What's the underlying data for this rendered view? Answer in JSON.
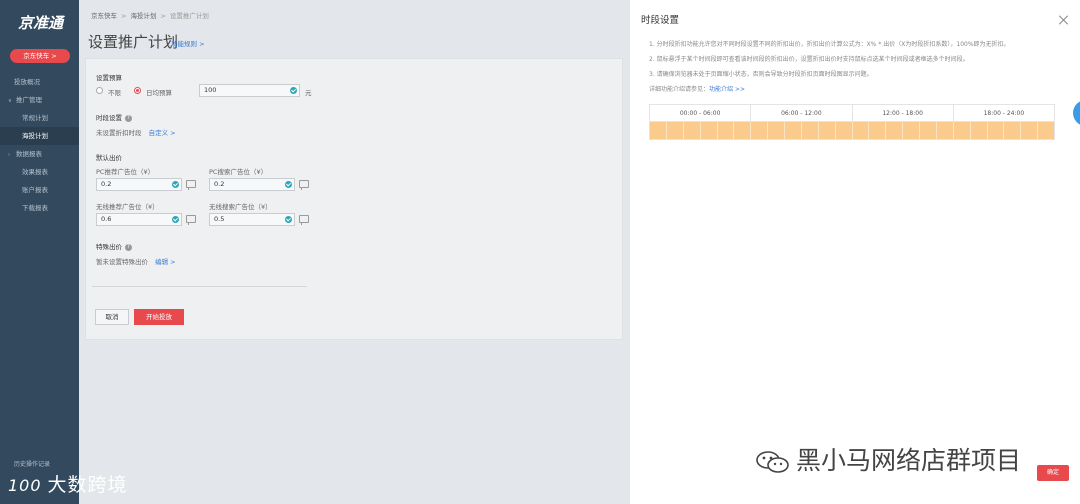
{
  "sidebar": {
    "logo": "京准通",
    "brand_button": "京东快车 >",
    "items": [
      {
        "label": "投放概况",
        "type": "item"
      },
      {
        "label": "推广管理",
        "type": "group"
      },
      {
        "label": "常规计划",
        "type": "sub"
      },
      {
        "label": "海投计划",
        "type": "sub",
        "active": true
      },
      {
        "label": "数据报表",
        "type": "group"
      },
      {
        "label": "效果报表",
        "type": "sub"
      },
      {
        "label": "账户报表",
        "type": "sub"
      },
      {
        "label": "下载报表",
        "type": "sub"
      }
    ],
    "footer": "历史操作记录"
  },
  "main": {
    "breadcrumb": [
      "京东快车",
      "海投计划",
      "设置推广计划"
    ],
    "title": "设置推广计划",
    "title_link": "功能规则 >",
    "budget": {
      "label": "设置预算",
      "option_unlimited": "不限",
      "option_daily": "日均预算",
      "value": "100",
      "unit": "元"
    },
    "time_setting": {
      "label": "时段设置",
      "status": "未设置折扣时段",
      "link": "自定义 >"
    },
    "default_bid": {
      "label": "默认出价",
      "pc_recommend_label": "PC推荐广告位（¥）",
      "pc_recommend_value": "0.2",
      "pc_search_label": "PC搜索广告位（¥）",
      "pc_search_value": "0.2",
      "mobile_recommend_label": "无线推荐广告位（¥）",
      "mobile_recommend_value": "0.6",
      "mobile_search_label": "无线搜索广告位（¥）",
      "mobile_search_value": "0.5"
    },
    "special_bid": {
      "label": "特殊出价",
      "status": "暂未设置特殊出价",
      "link": "编辑 >"
    },
    "cancel_button": "取消",
    "start_button": "开始投放"
  },
  "panel": {
    "title": "时段设置",
    "notes": [
      "1. 分时段折扣功能允许您对不同时段设置不同的折扣出价，折扣出价计算公式为：X% * 出价（X为时段折扣系数），100%即为无折扣。",
      "2. 鼠标悬浮于某个时间段即可查看该时间段的折扣出价，设置折扣出价时支持鼠标点选某个时间段或者框选多个时间段。",
      "3. 请确保浏览器未处于页面缩小状态，否则会导致分时段折扣页面时段图显示问题。"
    ],
    "detail_prefix": "详细功能介绍请参见：",
    "detail_link": "功能介绍 >>",
    "grid_headers": [
      "00:00 - 06:00",
      "06:00 - 12:00",
      "12:00 - 18:00",
      "18:00 - 24:00"
    ],
    "grid_hours": 24,
    "confirm_button": "确定"
  },
  "colors": {
    "accent_red": "#e8494c",
    "sidebar_bg": "#334a5e",
    "link_blue": "#3a7bd5",
    "slot_orange": "#fbcb8d"
  },
  "watermark_left": "大数跨境",
  "watermark_left_logo": "100",
  "watermark_right": "黑小马网络店群项目"
}
